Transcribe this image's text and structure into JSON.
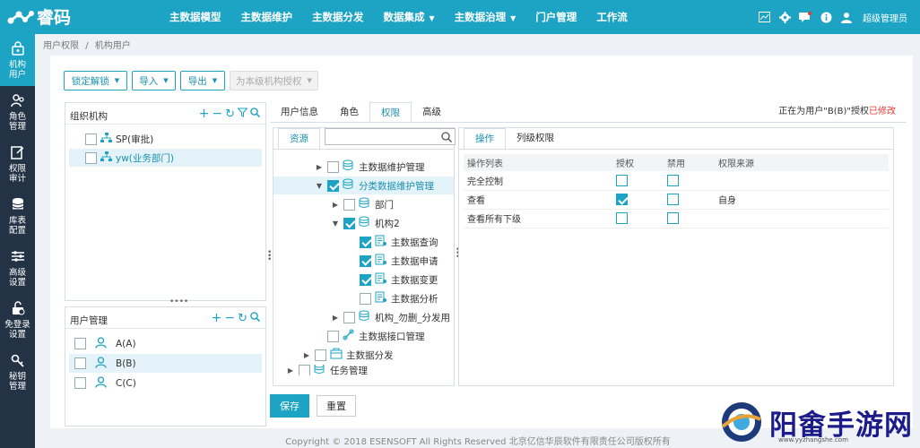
{
  "app": {
    "logo_text": "睿码"
  },
  "nav": [
    {
      "label": "主数据模型",
      "dropdown": false
    },
    {
      "label": "主数据维护",
      "dropdown": false
    },
    {
      "label": "主数据分发",
      "dropdown": false
    },
    {
      "label": "数据集成",
      "dropdown": true
    },
    {
      "label": "主数据治理",
      "dropdown": true
    },
    {
      "label": "门户管理",
      "dropdown": false
    },
    {
      "label": "工作流",
      "dropdown": false
    }
  ],
  "topright": {
    "user": "超级管理员"
  },
  "sidebar": [
    {
      "label": "机构\n用户",
      "icon": "lock-user-icon",
      "active": true
    },
    {
      "label": "角色\n管理",
      "icon": "users-icon"
    },
    {
      "label": "权限\n审计",
      "icon": "audit-icon"
    },
    {
      "label": "库表\n配置",
      "icon": "database-icon"
    },
    {
      "label": "高级\n设置",
      "icon": "sliders-icon"
    },
    {
      "label": "免登录\n设置",
      "icon": "unlock-icon"
    },
    {
      "label": "秘钥\n管理",
      "icon": "key-icon"
    }
  ],
  "breadcrumb": {
    "parent": "用户权限",
    "sep": "/",
    "current": "机构用户"
  },
  "toolbar": {
    "lock": "锁定解锁",
    "import": "导入",
    "export": "导出",
    "grant": "为本级机构授权"
  },
  "org": {
    "title": "组织机构",
    "items": [
      "SP(审批)",
      "yw(业务部门)"
    ]
  },
  "users": {
    "title": "用户管理",
    "items": [
      "A(A)",
      "B(B)",
      "C(C)"
    ]
  },
  "tabs": [
    "用户信息",
    "角色",
    "权限",
    "高级"
  ],
  "status": {
    "prefix": "正在为用户\"B(B)\"授权",
    "flag": "已修改"
  },
  "resource": {
    "tab": "资源",
    "search_placeholder": "",
    "tree": [
      {
        "label": "主数据维护管理",
        "level": 1,
        "toggle": "▶",
        "checked": false
      },
      {
        "label": "分类数据维护管理",
        "level": 1,
        "toggle": "▼",
        "checked": true
      },
      {
        "label": "部门",
        "level": 2,
        "toggle": "▶",
        "checked": false
      },
      {
        "label": "机构2",
        "level": 2,
        "toggle": "▼",
        "checked": true
      },
      {
        "label": "主数据查询",
        "level": 3,
        "toggle": "",
        "checked": true
      },
      {
        "label": "主数据申请",
        "level": 3,
        "toggle": "",
        "checked": true
      },
      {
        "label": "主数据变更",
        "level": 3,
        "toggle": "",
        "checked": true
      },
      {
        "label": "主数据分析",
        "level": 3,
        "toggle": "",
        "checked": false
      },
      {
        "label": "机构_勿删_分发用",
        "level": 2,
        "toggle": "▶",
        "checked": false
      },
      {
        "label": "主数据接口管理",
        "level": 1,
        "toggle": "",
        "checked": false
      },
      {
        "label": "主数据分发",
        "level": 0,
        "toggle": "▶",
        "checked": false
      },
      {
        "label": "任务管理",
        "level": -1,
        "toggle": "▶",
        "checked": false
      }
    ]
  },
  "ops": {
    "tabs": [
      "操作",
      "列级权限"
    ],
    "headers": [
      "操作列表",
      "授权",
      "禁用",
      "权限来源"
    ],
    "rows": [
      {
        "name": "完全控制",
        "grant": false,
        "deny": false,
        "source": ""
      },
      {
        "name": "查看",
        "grant": true,
        "deny": false,
        "source": "自身"
      },
      {
        "name": "查看所有下级",
        "grant": false,
        "deny": false,
        "source": ""
      }
    ]
  },
  "actions": {
    "save": "保存",
    "reset": "重置"
  },
  "footer": "Copyright © 2018 ESENSOFT All Rights Reserved 北京亿信华辰软件有限责任公司版权所有",
  "watermark": {
    "text": "阳畬手游网",
    "sub": "www.yyzhangshe.com"
  }
}
